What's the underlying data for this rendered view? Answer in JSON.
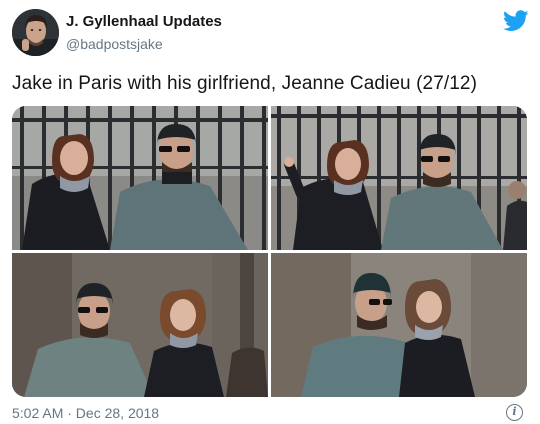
{
  "tweet": {
    "display_name": "J. Gyllenhaal Updates",
    "handle": "@badpostsjake",
    "text": "Jake in Paris with his girlfriend, Jeanne Cadieu (27/12)",
    "timestamp": "5:02 AM · Dec 28, 2018"
  },
  "icons": {
    "brand": "twitter-bird-icon",
    "info": "info-icon",
    "info_glyph": "i"
  },
  "colors": {
    "brand_blue": "#1da1f2",
    "secondary_text": "#657786",
    "primary_text": "#14171a"
  }
}
